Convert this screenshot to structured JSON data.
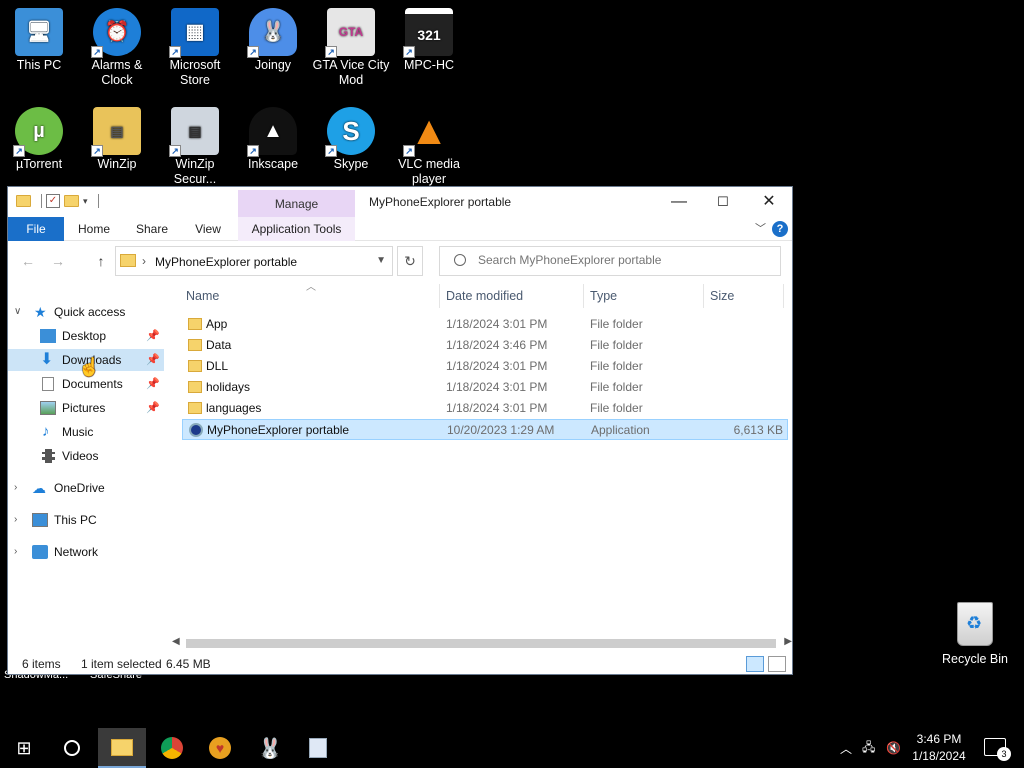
{
  "desktop": {
    "icons": [
      {
        "label": "This PC",
        "icon": "this-pc-icon"
      },
      {
        "label": "Alarms & Clock",
        "icon": "alarm-clock-icon"
      },
      {
        "label": "Microsoft Store",
        "icon": "store-icon"
      },
      {
        "label": "Joingy",
        "icon": "joingy-icon"
      },
      {
        "label": "GTA Vice City Mod",
        "icon": "gta-icon"
      },
      {
        "label": "MPC-HC",
        "icon": "mpc-hc-icon"
      },
      {
        "label": "µTorrent",
        "icon": "utorrent-icon"
      },
      {
        "label": "WinZip",
        "icon": "winzip-icon"
      },
      {
        "label": "WinZip Secur...",
        "icon": "winzip-secure-icon"
      },
      {
        "label": "Inkscape",
        "icon": "inkscape-icon"
      },
      {
        "label": "Skype",
        "icon": "skype-icon"
      },
      {
        "label": "VLC media player",
        "icon": "vlc-icon"
      }
    ],
    "behind_labels": [
      "ShadowMa...",
      "SafeShare"
    ],
    "recycle_bin": "Recycle Bin"
  },
  "window": {
    "title": "MyPhoneExplorer portable",
    "manage_tab": "Manage",
    "ribbon": {
      "file": "File",
      "home": "Home",
      "share": "Share",
      "view": "View",
      "app_tools": "Application Tools"
    },
    "address": {
      "crumb": "MyPhoneExplorer portable"
    },
    "search_placeholder": "Search MyPhoneExplorer portable",
    "nav": {
      "quick_access": "Quick access",
      "desktop": "Desktop",
      "downloads": "Downloads",
      "documents": "Documents",
      "pictures": "Pictures",
      "music": "Music",
      "videos": "Videos",
      "onedrive": "OneDrive",
      "this_pc": "This PC",
      "network": "Network"
    },
    "columns": {
      "name": "Name",
      "date": "Date modified",
      "type": "Type",
      "size": "Size"
    },
    "files": [
      {
        "name": "App",
        "date": "1/18/2024 3:01 PM",
        "type": "File folder",
        "size": ""
      },
      {
        "name": "Data",
        "date": "1/18/2024 3:46 PM",
        "type": "File folder",
        "size": ""
      },
      {
        "name": "DLL",
        "date": "1/18/2024 3:01 PM",
        "type": "File folder",
        "size": ""
      },
      {
        "name": "holidays",
        "date": "1/18/2024 3:01 PM",
        "type": "File folder",
        "size": ""
      },
      {
        "name": "languages",
        "date": "1/18/2024 3:01 PM",
        "type": "File folder",
        "size": ""
      },
      {
        "name": "MyPhoneExplorer portable",
        "date": "10/20/2023 1:29 AM",
        "type": "Application",
        "size": "6,613 KB"
      }
    ],
    "status": {
      "items": "6 items",
      "selected": "1 item selected",
      "size": "6.45 MB"
    }
  },
  "taskbar": {
    "time": "3:46 PM",
    "date": "1/18/2024",
    "notification_count": "3"
  }
}
